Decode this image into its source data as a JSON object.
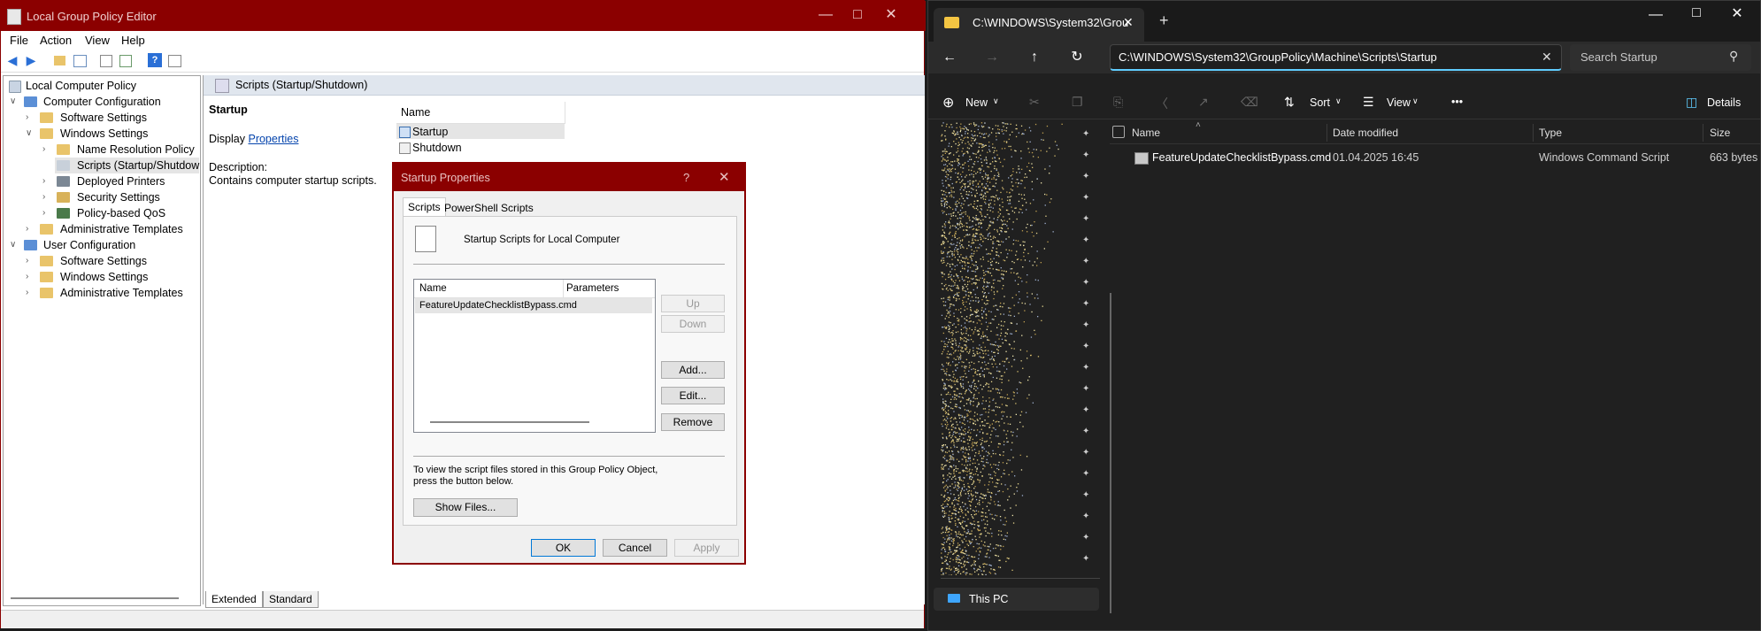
{
  "gpe": {
    "title": "Local Group Policy Editor",
    "menu": [
      "File",
      "Action",
      "View",
      "Help"
    ],
    "tree": [
      {
        "label": "Local Computer Policy"
      },
      {
        "label": "Computer Configuration"
      },
      {
        "label": "Software Settings"
      },
      {
        "label": "Windows Settings"
      },
      {
        "label": "Name Resolution Policy"
      },
      {
        "label": "Scripts (Startup/Shutdown)"
      },
      {
        "label": "Deployed Printers"
      },
      {
        "label": "Security Settings"
      },
      {
        "label": "Policy-based QoS"
      },
      {
        "label": "Administrative Templates"
      },
      {
        "label": "User Configuration"
      },
      {
        "label": "Software Settings"
      },
      {
        "label": "Windows Settings"
      },
      {
        "label": "Administrative Templates"
      }
    ],
    "header": "Scripts (Startup/Shutdown)",
    "detail": {
      "heading": "Startup",
      "display_prefix": "Display",
      "display_link": "Properties",
      "description_label": "Description:",
      "description_text": "Contains computer startup scripts."
    },
    "list_header": "Name",
    "list_items": [
      "Startup",
      "Shutdown"
    ],
    "bottom_tabs": [
      "Extended",
      "Standard"
    ]
  },
  "dialog": {
    "title": "Startup Properties",
    "help": "?",
    "tabs": [
      "Scripts",
      "PowerShell Scripts"
    ],
    "heading": "Startup Scripts for Local Computer",
    "columns": [
      "Name",
      "Parameters"
    ],
    "rows": [
      "FeatureUpdateChecklistBypass.cmd"
    ],
    "buttons": {
      "up": "Up",
      "down": "Down",
      "add": "Add...",
      "edit": "Edit...",
      "remove": "Remove"
    },
    "info": "To view the script files stored in this Group Policy Object, press the button below.",
    "show_files": "Show Files...",
    "ok": "OK",
    "cancel": "Cancel",
    "apply": "Apply"
  },
  "explorer": {
    "tab_title": "C:\\WINDOWS\\System32\\Grou",
    "address": "C:\\WINDOWS\\System32\\GroupPolicy\\Machine\\Scripts\\Startup",
    "search_placeholder": "Search Startup",
    "commands": {
      "new": "New",
      "sort": "Sort",
      "view": "View",
      "more": "•••",
      "details": "Details"
    },
    "columns": [
      "Name",
      "Date modified",
      "Type",
      "Size"
    ],
    "files": [
      {
        "name": "FeatureUpdateChecklistBypass.cmd",
        "date": "01.04.2025 16:45",
        "type": "Windows Command Script",
        "size": "663 bytes"
      }
    ],
    "nav_this_pc": "This PC"
  },
  "colors": {
    "gpe_titlebar": "#8b0000",
    "explorer_bg": "#202020",
    "accent": "#60cdff",
    "folder": "#e9c46a"
  }
}
